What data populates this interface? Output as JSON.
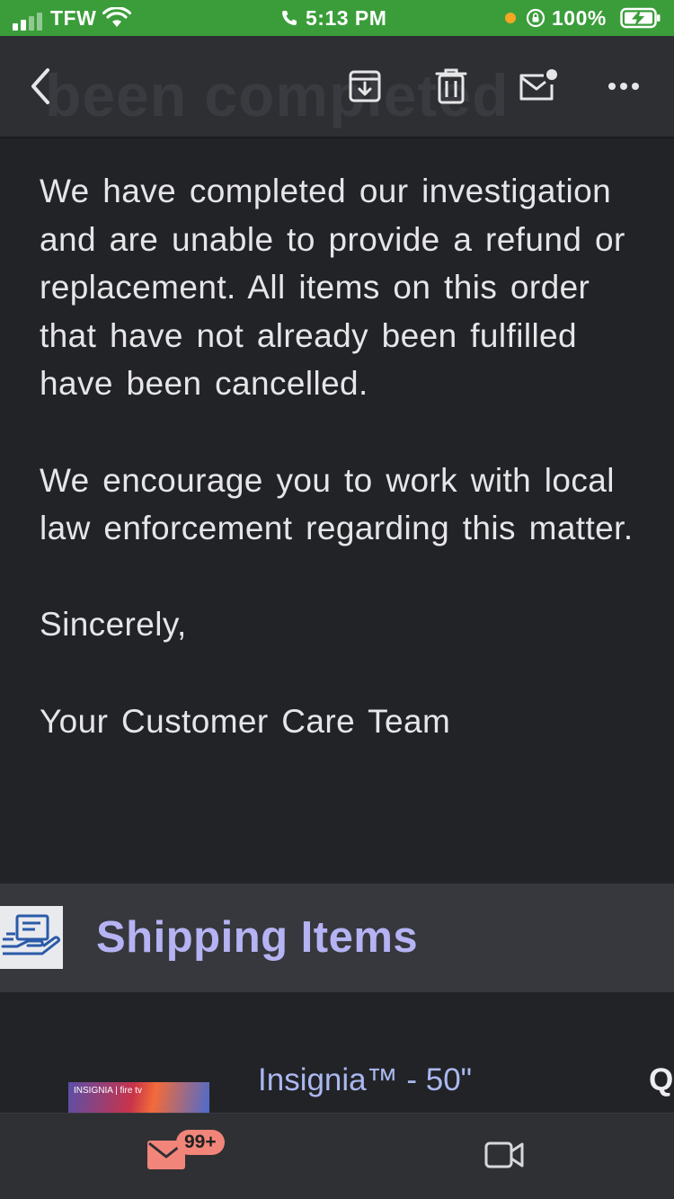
{
  "status_bar": {
    "carrier": "TFW",
    "time": "5:13 PM",
    "battery": "100%",
    "icons": [
      "signal-icon",
      "wifi-icon",
      "phone-icon",
      "orientation-lock-icon",
      "battery-charging-icon"
    ]
  },
  "toolbar": {
    "ghost_title": "been completed",
    "icons": [
      "back-icon",
      "archive-icon",
      "trash-icon",
      "mark-unread-icon",
      "more-icon"
    ]
  },
  "email": {
    "paragraphs": [
      "We have completed our investigation and are unable to provide a refund or replacement. All items on this order that have not already been fulfilled have been cancelled.",
      "We encourage you to work with local law enforcement regarding this matter.",
      "Sincerely,",
      "Your Customer Care Team"
    ]
  },
  "shipping": {
    "title": "Shipping Items",
    "product_title_line1": "Insignia™ - 50\"",
    "product_brand": "INSIGNIA | fire tv",
    "qty_label": "Q"
  },
  "bottom_nav": {
    "mail_badge": "99+",
    "icons": [
      "mail-icon",
      "video-icon"
    ]
  },
  "colors": {
    "status_green": "#3a9d3a",
    "background": "#222327",
    "accent_lavender": "#b5b3f3",
    "badge": "#f2857a"
  }
}
